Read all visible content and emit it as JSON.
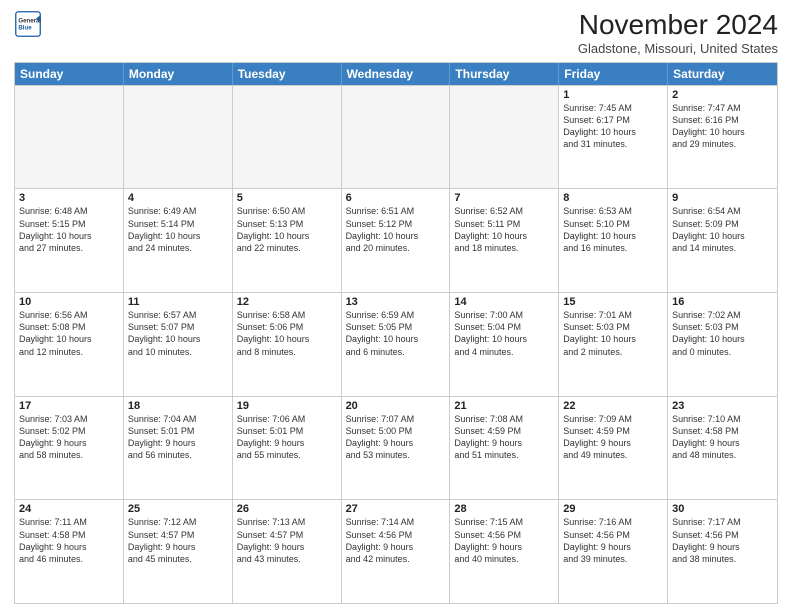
{
  "header": {
    "logo_general": "General",
    "logo_blue": "Blue",
    "month_title": "November 2024",
    "location": "Gladstone, Missouri, United States"
  },
  "weekdays": [
    "Sunday",
    "Monday",
    "Tuesday",
    "Wednesday",
    "Thursday",
    "Friday",
    "Saturday"
  ],
  "rows": [
    [
      {
        "day": "",
        "info": "",
        "empty": true
      },
      {
        "day": "",
        "info": "",
        "empty": true
      },
      {
        "day": "",
        "info": "",
        "empty": true
      },
      {
        "day": "",
        "info": "",
        "empty": true
      },
      {
        "day": "",
        "info": "",
        "empty": true
      },
      {
        "day": "1",
        "info": "Sunrise: 7:45 AM\nSunset: 6:17 PM\nDaylight: 10 hours\nand 31 minutes.",
        "empty": false
      },
      {
        "day": "2",
        "info": "Sunrise: 7:47 AM\nSunset: 6:16 PM\nDaylight: 10 hours\nand 29 minutes.",
        "empty": false
      }
    ],
    [
      {
        "day": "3",
        "info": "Sunrise: 6:48 AM\nSunset: 5:15 PM\nDaylight: 10 hours\nand 27 minutes.",
        "empty": false
      },
      {
        "day": "4",
        "info": "Sunrise: 6:49 AM\nSunset: 5:14 PM\nDaylight: 10 hours\nand 24 minutes.",
        "empty": false
      },
      {
        "day": "5",
        "info": "Sunrise: 6:50 AM\nSunset: 5:13 PM\nDaylight: 10 hours\nand 22 minutes.",
        "empty": false
      },
      {
        "day": "6",
        "info": "Sunrise: 6:51 AM\nSunset: 5:12 PM\nDaylight: 10 hours\nand 20 minutes.",
        "empty": false
      },
      {
        "day": "7",
        "info": "Sunrise: 6:52 AM\nSunset: 5:11 PM\nDaylight: 10 hours\nand 18 minutes.",
        "empty": false
      },
      {
        "day": "8",
        "info": "Sunrise: 6:53 AM\nSunset: 5:10 PM\nDaylight: 10 hours\nand 16 minutes.",
        "empty": false
      },
      {
        "day": "9",
        "info": "Sunrise: 6:54 AM\nSunset: 5:09 PM\nDaylight: 10 hours\nand 14 minutes.",
        "empty": false
      }
    ],
    [
      {
        "day": "10",
        "info": "Sunrise: 6:56 AM\nSunset: 5:08 PM\nDaylight: 10 hours\nand 12 minutes.",
        "empty": false
      },
      {
        "day": "11",
        "info": "Sunrise: 6:57 AM\nSunset: 5:07 PM\nDaylight: 10 hours\nand 10 minutes.",
        "empty": false
      },
      {
        "day": "12",
        "info": "Sunrise: 6:58 AM\nSunset: 5:06 PM\nDaylight: 10 hours\nand 8 minutes.",
        "empty": false
      },
      {
        "day": "13",
        "info": "Sunrise: 6:59 AM\nSunset: 5:05 PM\nDaylight: 10 hours\nand 6 minutes.",
        "empty": false
      },
      {
        "day": "14",
        "info": "Sunrise: 7:00 AM\nSunset: 5:04 PM\nDaylight: 10 hours\nand 4 minutes.",
        "empty": false
      },
      {
        "day": "15",
        "info": "Sunrise: 7:01 AM\nSunset: 5:03 PM\nDaylight: 10 hours\nand 2 minutes.",
        "empty": false
      },
      {
        "day": "16",
        "info": "Sunrise: 7:02 AM\nSunset: 5:03 PM\nDaylight: 10 hours\nand 0 minutes.",
        "empty": false
      }
    ],
    [
      {
        "day": "17",
        "info": "Sunrise: 7:03 AM\nSunset: 5:02 PM\nDaylight: 9 hours\nand 58 minutes.",
        "empty": false
      },
      {
        "day": "18",
        "info": "Sunrise: 7:04 AM\nSunset: 5:01 PM\nDaylight: 9 hours\nand 56 minutes.",
        "empty": false
      },
      {
        "day": "19",
        "info": "Sunrise: 7:06 AM\nSunset: 5:01 PM\nDaylight: 9 hours\nand 55 minutes.",
        "empty": false
      },
      {
        "day": "20",
        "info": "Sunrise: 7:07 AM\nSunset: 5:00 PM\nDaylight: 9 hours\nand 53 minutes.",
        "empty": false
      },
      {
        "day": "21",
        "info": "Sunrise: 7:08 AM\nSunset: 4:59 PM\nDaylight: 9 hours\nand 51 minutes.",
        "empty": false
      },
      {
        "day": "22",
        "info": "Sunrise: 7:09 AM\nSunset: 4:59 PM\nDaylight: 9 hours\nand 49 minutes.",
        "empty": false
      },
      {
        "day": "23",
        "info": "Sunrise: 7:10 AM\nSunset: 4:58 PM\nDaylight: 9 hours\nand 48 minutes.",
        "empty": false
      }
    ],
    [
      {
        "day": "24",
        "info": "Sunrise: 7:11 AM\nSunset: 4:58 PM\nDaylight: 9 hours\nand 46 minutes.",
        "empty": false
      },
      {
        "day": "25",
        "info": "Sunrise: 7:12 AM\nSunset: 4:57 PM\nDaylight: 9 hours\nand 45 minutes.",
        "empty": false
      },
      {
        "day": "26",
        "info": "Sunrise: 7:13 AM\nSunset: 4:57 PM\nDaylight: 9 hours\nand 43 minutes.",
        "empty": false
      },
      {
        "day": "27",
        "info": "Sunrise: 7:14 AM\nSunset: 4:56 PM\nDaylight: 9 hours\nand 42 minutes.",
        "empty": false
      },
      {
        "day": "28",
        "info": "Sunrise: 7:15 AM\nSunset: 4:56 PM\nDaylight: 9 hours\nand 40 minutes.",
        "empty": false
      },
      {
        "day": "29",
        "info": "Sunrise: 7:16 AM\nSunset: 4:56 PM\nDaylight: 9 hours\nand 39 minutes.",
        "empty": false
      },
      {
        "day": "30",
        "info": "Sunrise: 7:17 AM\nSunset: 4:56 PM\nDaylight: 9 hours\nand 38 minutes.",
        "empty": false
      }
    ]
  ]
}
